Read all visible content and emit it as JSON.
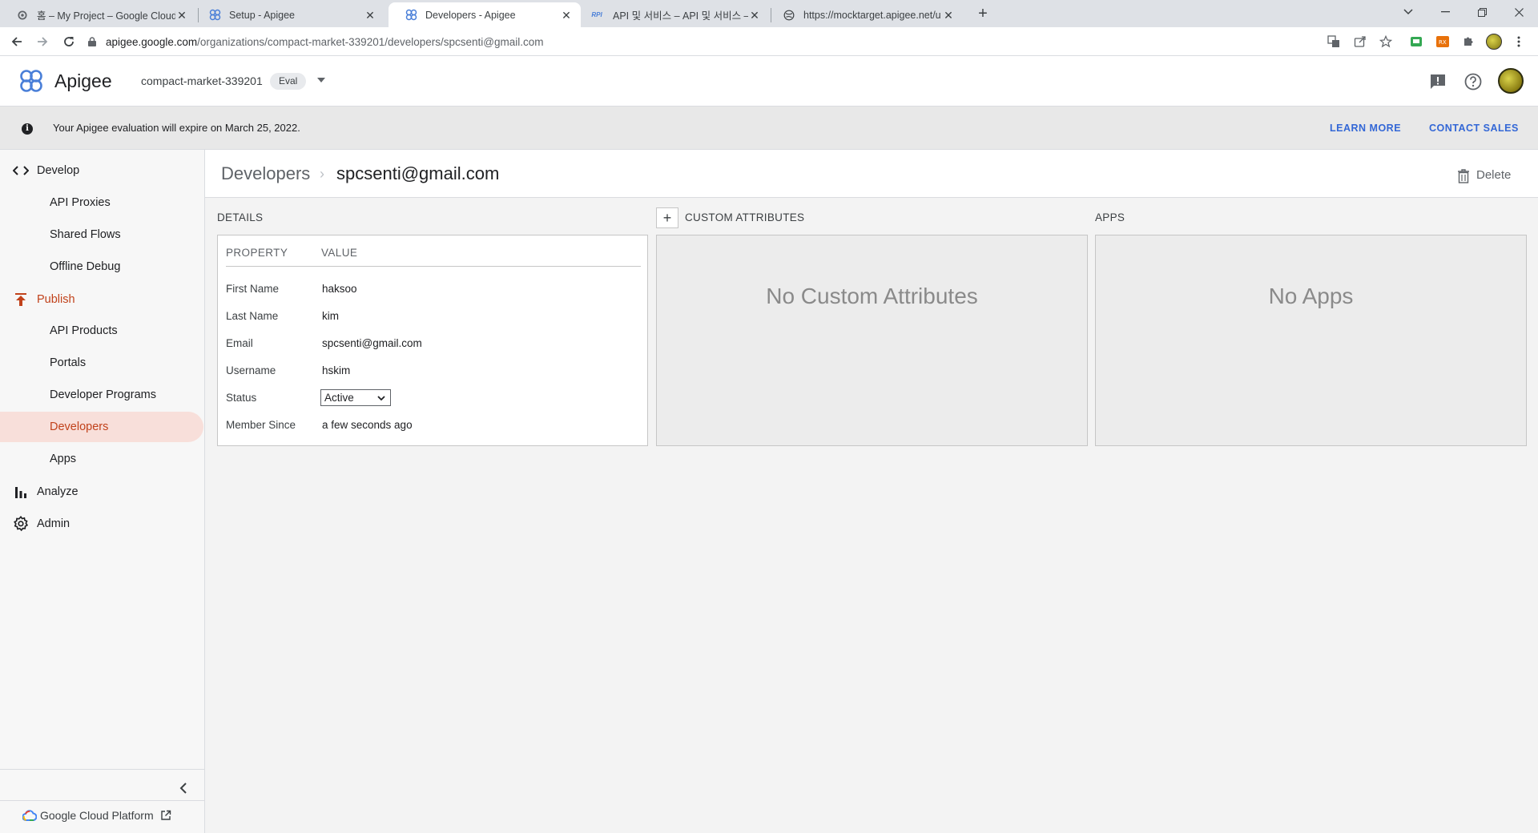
{
  "browser": {
    "tabs": [
      {
        "title": "홈 – My Project – Google Cloud",
        "icon": "gear-icon"
      },
      {
        "title": "Setup - Apigee",
        "icon": "apigee-icon"
      },
      {
        "title": "Developers - Apigee",
        "icon": "apigee-icon",
        "active": true
      },
      {
        "title": "API 및 서비스 – API 및 서비스 –",
        "icon": "api-icon",
        "icon_text": "RPI"
      },
      {
        "title": "https://mocktarget.apigee.net/u",
        "icon": "globe-icon"
      }
    ],
    "url_host": "apigee.google.com",
    "url_path": "/organizations/compact-market-339201/developers/spcsenti@gmail.com"
  },
  "header": {
    "brand": "Apigee",
    "org": "compact-market-339201",
    "badge": "Eval"
  },
  "banner": {
    "message": "Your Apigee evaluation will expire on March 25, 2022.",
    "learn_more": "LEARN MORE",
    "contact_sales": "CONTACT SALES"
  },
  "sidebar": {
    "develop": "Develop",
    "develop_items": [
      "API Proxies",
      "Shared Flows",
      "Offline Debug"
    ],
    "publish": "Publish",
    "publish_items": [
      "API Products",
      "Portals",
      "Developer Programs",
      "Developers",
      "Apps"
    ],
    "analyze": "Analyze",
    "admin": "Admin",
    "gcp_link": "Google Cloud Platform",
    "selected": "Developers"
  },
  "page": {
    "breadcrumb_parent": "Developers",
    "breadcrumb_separator": "›",
    "breadcrumb_current": "spcsenti@gmail.com",
    "delete_label": "Delete",
    "details_label": "DETAILS",
    "custom_attributes_label": "CUSTOM ATTRIBUTES",
    "add_attribute_symbol": "+",
    "apps_label": "APPS",
    "col_property": "PROPERTY",
    "col_value": "VALUE",
    "properties": [
      {
        "name": "First Name",
        "value": "haksoo"
      },
      {
        "name": "Last Name",
        "value": "kim"
      },
      {
        "name": "Email",
        "value": "spcsenti@gmail.com"
      },
      {
        "name": "Username",
        "value": "hskim"
      },
      {
        "name": "Status",
        "value": "Active"
      },
      {
        "name": "Member Since",
        "value": "a few seconds ago"
      }
    ],
    "no_custom_attributes": "No Custom Attributes",
    "no_apps": "No Apps"
  }
}
